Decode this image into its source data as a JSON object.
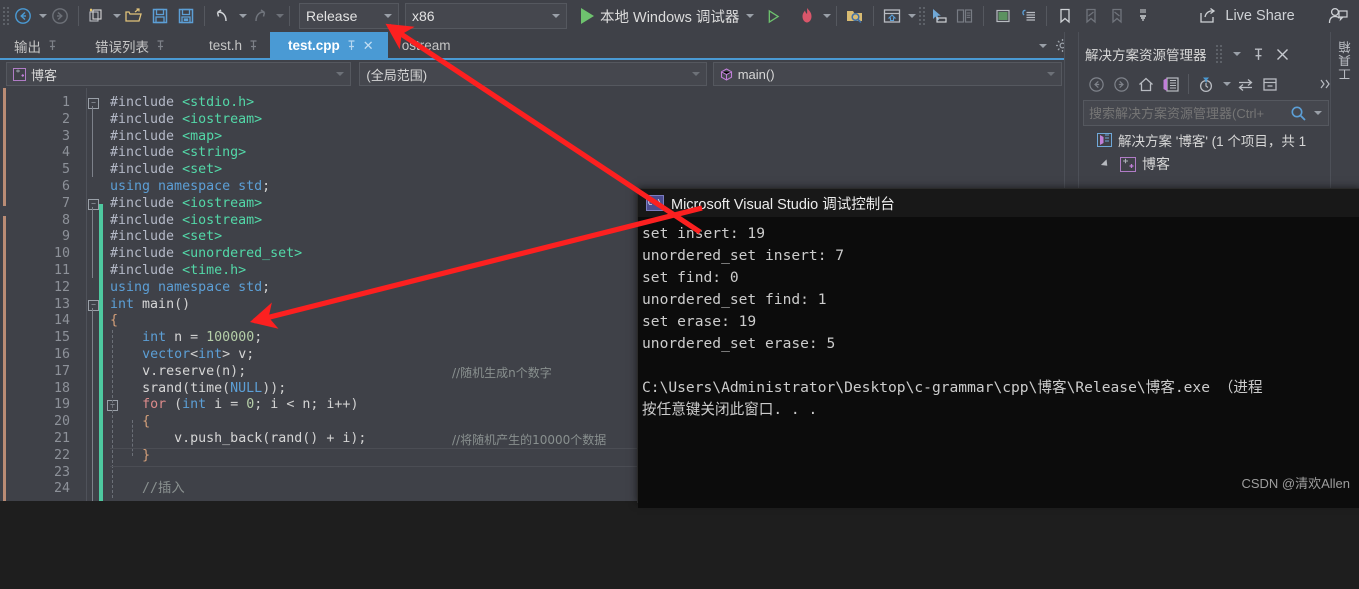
{
  "toolbar": {
    "navigate_back": "navigate-back",
    "navigate_forward": "navigate-forward",
    "config_value": "Release",
    "platform_value": "x86",
    "run_label": "本地 Windows 调试器",
    "live_share_label": "Live Share"
  },
  "tabs": [
    {
      "label": "输出",
      "pinned": true,
      "active": false
    },
    {
      "label": "错误列表",
      "pinned": true,
      "active": false
    },
    {
      "label": "test.h",
      "pinned": true,
      "active": false
    },
    {
      "label": "test.cpp",
      "pinned": true,
      "active": true,
      "closable": true
    },
    {
      "label": "ostream",
      "pinned": false,
      "active": false
    }
  ],
  "navbar": {
    "project_value": "博客",
    "scope_value": "(全局范围)",
    "member_value": "main()"
  },
  "code": {
    "lines": [
      {
        "n": 1,
        "text": "#include <stdio.h>"
      },
      {
        "n": 2,
        "text": "#include <iostream>"
      },
      {
        "n": 3,
        "text": "#include <map>"
      },
      {
        "n": 4,
        "text": "#include <string>"
      },
      {
        "n": 5,
        "text": "#include <set>"
      },
      {
        "n": 6,
        "text": "using namespace std;"
      },
      {
        "n": 7,
        "text": "#include <iostream>"
      },
      {
        "n": 8,
        "text": "#include <iostream>"
      },
      {
        "n": 9,
        "text": "#include <set>"
      },
      {
        "n": 10,
        "text": "#include <unordered_set>"
      },
      {
        "n": 11,
        "text": "#include <time.h>"
      },
      {
        "n": 12,
        "text": "using namespace std;"
      },
      {
        "n": 13,
        "text": "int main()"
      },
      {
        "n": 14,
        "text": "{"
      },
      {
        "n": 15,
        "text": "    int n = 100000;"
      },
      {
        "n": 16,
        "text": "    vector<int> v;"
      },
      {
        "n": 17,
        "text": "    v.reserve(n);"
      },
      {
        "n": 18,
        "text": "    srand(time(NULL));"
      },
      {
        "n": 19,
        "text": "    for (int i = 0; i < n; i++)"
      },
      {
        "n": 20,
        "text": "    {"
      },
      {
        "n": 21,
        "text": "        v.push_back(rand() + i);"
      },
      {
        "n": 22,
        "text": "    }"
      },
      {
        "n": 23,
        "text": ""
      },
      {
        "n": 24,
        "text": "    //插入"
      }
    ],
    "comments": [
      {
        "line": 17,
        "text": "//随机生成n个数字"
      },
      {
        "line": 21,
        "text": "//将随机产生的10000个数据"
      }
    ]
  },
  "solution_explorer": {
    "title": "解决方案资源管理器",
    "search_placeholder": "搜索解决方案资源管理器(Ctrl+",
    "nodes": [
      {
        "label": "解决方案 '博客' (1 个项目，共 1",
        "indent": 1,
        "arrow": "none"
      },
      {
        "label": "博客",
        "indent": 2,
        "arrow": "collapse"
      }
    ]
  },
  "toolbox": {
    "label": "工具箱"
  },
  "console": {
    "title": "Microsoft Visual Studio 调试控制台",
    "icon_text": "C:\\",
    "output_lines": [
      "set insert: 19",
      "unordered_set insert: 7",
      "set find: 0",
      "unordered_set find: 1",
      "set erase: 19",
      "unordered_set erase: 5"
    ],
    "path_line": "C:\\Users\\Administrator\\Desktop\\c-grammar\\cpp\\博客\\Release\\博客.exe （进程",
    "prompt_line": "按任意键关闭此窗口. . ."
  },
  "watermark": "CSDN @清欢Allen",
  "colors": {
    "accent_blue": "#4a9ad4",
    "arrow_red": "#fc2020",
    "change_green": "#4ec9a0",
    "chrome_bg": "#3f4148",
    "console_bg": "#0c0c0c"
  }
}
